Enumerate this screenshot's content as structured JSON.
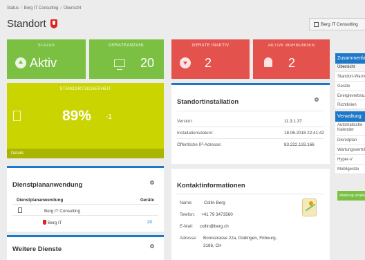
{
  "breadcrumb": [
    "Status",
    "Berg IT Consulting",
    "Übersicht"
  ],
  "page_title": "Standort",
  "company_button": "Berg IT Consulting",
  "tiles": {
    "status": {
      "header": "STATUS",
      "value": "Aktiv"
    },
    "device_count": {
      "header": "GERÄTEANZAHL",
      "value": "20"
    },
    "inactive": {
      "header": "GERÄTE INAKTIV",
      "value": "2"
    },
    "warnings": {
      "header": "AKTIVE WARNUNGEN",
      "value": "2"
    }
  },
  "colors": {
    "green": "#7bc043",
    "red": "#e4524d",
    "blue": "#1e78c8",
    "yellow": "#c9d400"
  },
  "security": {
    "header": "STANDORTSICHERHEIT",
    "percent": "89%",
    "trend": "-1",
    "details": "Details"
  },
  "installation": {
    "title": "Standortinstallation",
    "rows": [
      {
        "label": "Version:",
        "value": "11.3.1.37"
      },
      {
        "label": "Installationsdatum:",
        "value": "18.06.2018 22:41:42"
      },
      {
        "label": "Öffentliche IP-Adresse:",
        "value": "83.222.133.166"
      }
    ]
  },
  "dienstplan": {
    "title": "Dienstplananwendung",
    "col1": "Dienstplananwendung",
    "col2": "Geräte",
    "group": "Berg IT Consulting",
    "item": "Berg IT",
    "item_count": "20"
  },
  "contact": {
    "title": "Kontaktinformationen",
    "rows": [
      {
        "label": "Name:",
        "value": "Collin Berg"
      },
      {
        "label": "Telefon:",
        "value": "+41 79 3473560"
      },
      {
        "label": "E-Mail:",
        "value": "collin@berg.ch"
      },
      {
        "label": "Adresse:",
        "value": "Bonnstrasse 22a, Düdingen, Fribourg,",
        "value2": "3186, CH"
      }
    ]
  },
  "weitere": {
    "title": "Weitere Dienste"
  },
  "sidebar": {
    "summary_header": "Zusammenfassung",
    "summary_items": [
      "Übersicht",
      "Standort-Warnungen",
      "Geräte",
      "Energieverbrauch",
      "Richtlinien"
    ],
    "admin_header": "Verwaltung",
    "admin_items": [
      "Automatische Kalender",
      "Dienstplan",
      "Wartungsverträge",
      "Hyper-V",
      "Mobilgeräte"
    ],
    "button": "Wartung einplanen"
  }
}
